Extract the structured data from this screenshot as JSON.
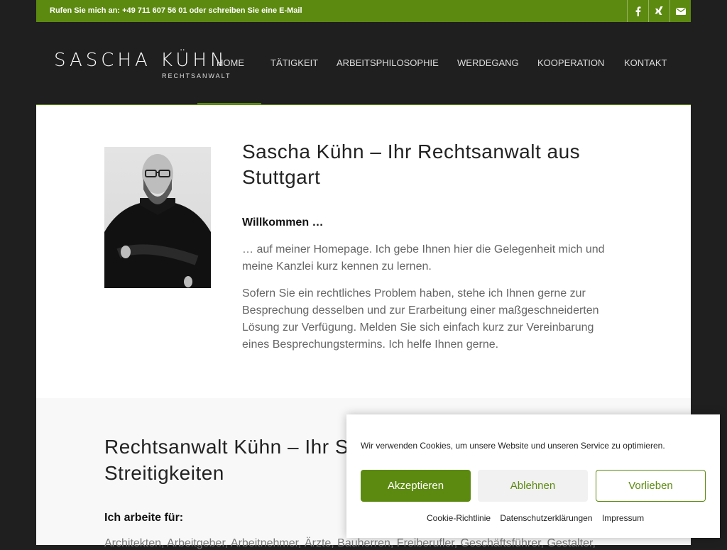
{
  "topbar": {
    "contact": "Rufen Sie mich an: +49 711 607 56 01 oder schreiben Sie eine E-Mail",
    "social": [
      {
        "icon": "facebook-icon"
      },
      {
        "icon": "xing-icon"
      },
      {
        "icon": "mail-icon"
      }
    ]
  },
  "header": {
    "logo_name": "SASCHA KÜHN",
    "logo_sub": "RECHTSANWALT",
    "nav": [
      {
        "label": "HOME",
        "active": true
      },
      {
        "label": "TÄTIGKEIT"
      },
      {
        "label": "ARBEITSPHILOSOPHIE"
      },
      {
        "label": "WERDEGANG"
      },
      {
        "label": "KOOPERATION"
      },
      {
        "label": "KONTAKT"
      }
    ]
  },
  "intro": {
    "title": "Sascha Kühn – Ihr Rechtsanwalt aus Stuttgart",
    "welcome": "Willkommen …",
    "p1": "… auf meiner Homepage. Ich gebe Ihnen hier die Gelegenheit mich und meine Kanzlei kurz kennen zu lernen.",
    "p2": "Sofern Sie ein rechtliches Problem haben, stehe ich Ihnen gerne zur Besprechung desselben und zur Erarbeitung einer maßgeschneiderten Lösung zur Verfügung. Melden Sie sich einfach kurz zur Vereinbarung eines Besprechungstermins. Ich helfe Ihnen gerne."
  },
  "section2": {
    "title": "Rechtsanwalt Kühn – Ihr S Streitigkeiten",
    "title_line1": "Rechtsanwalt Kühn – Ihr S",
    "title_line2": "Streitigkeiten",
    "for_label": "Ich arbeite für:",
    "list": "Architekten, Arbeitgeber, Arbeitnehmer, Ärzte, Bauherren, Freiberufler, Geschäftsführer, Gestalter,"
  },
  "cookie": {
    "message": "Wir verwenden Cookies, um unsere Website und unseren Service zu optimieren.",
    "accept": "Akzeptieren",
    "deny": "Ablehnen",
    "prefs": "Vorlieben",
    "links": [
      "Cookie-Richtlinie",
      "Datenschutzerklärungen",
      "Impressum"
    ]
  },
  "colors": {
    "accent": "#5c8a10",
    "dark": "#1f1f1f"
  }
}
